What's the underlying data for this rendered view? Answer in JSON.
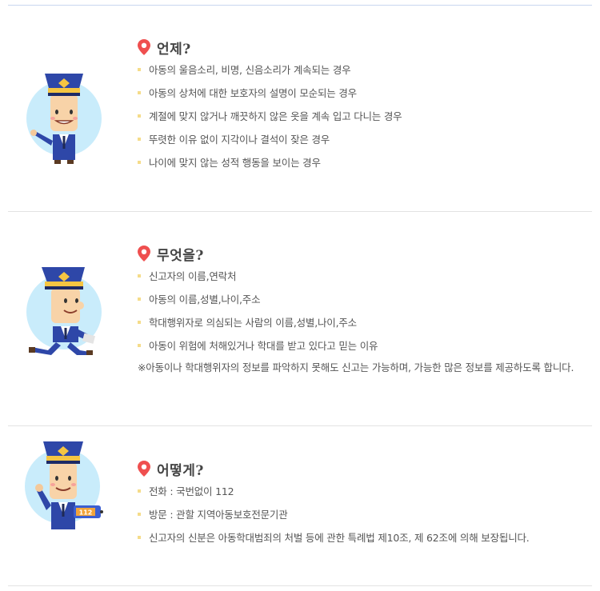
{
  "colors": {
    "pin": "#ef4f4f",
    "bullet": "#f5dc8a",
    "divider": "#e3e3e3",
    "top_rule": "#c9d6ef",
    "avatar_bg": "#c9ecfb",
    "uniform": "#2e47a8"
  },
  "sections": [
    {
      "title": "언제?",
      "avatar": "pointing-police-officer",
      "items": [
        "아동의 울음소리, 비명, 신음소리가 계속되는 경우",
        "아동의 상처에 대한 보호자의 설명이 모순되는 경우",
        "계절에 맞지 않거나 깨끗하지 않은 옷을 계속 입고 다니는 경우",
        "뚜렷한 이유 없이 지각이나 결석이 잦은 경우",
        "나이에 맞지 않는 성적 행동을 보이는 경우"
      ]
    },
    {
      "title": "무엇을?",
      "avatar": "running-police-officer",
      "items": [
        "신고자의 이름,연락처",
        "아동의 이름,성별,나이,주소",
        "학대행위자로 의심되는 사람의 이름,성별,나이,주소",
        "아동이 위험에 처해있거나 학대를 받고 있다고 믿는 이유"
      ],
      "note": "※아동이나 학대행위자의 정보를 파악하지 못해도 신고는 가능하며, 가능한 많은 정보를 제공하도록 합니다."
    },
    {
      "title": "어떻게?",
      "avatar": "phone-police-officer",
      "phone_label": "112",
      "items": [
        "전화 : 국번없이 112",
        "방문 : 관할 지역아동보호전문기관",
        "신고자의 신분은 아동학대범죄의 처벌 등에 관한 특례법 제10조, 제 62조에 의해 보장됩니다."
      ]
    }
  ]
}
